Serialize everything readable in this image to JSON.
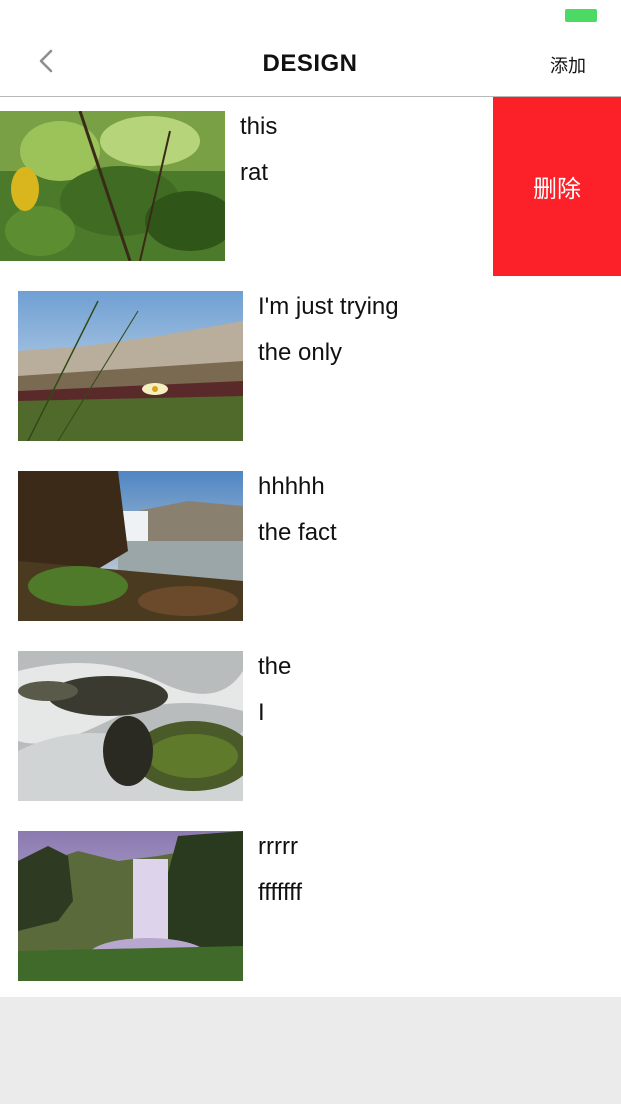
{
  "nav": {
    "title": "DESIGN",
    "add_label": "添加",
    "back_icon": "chevron-left-icon"
  },
  "status": {
    "battery_color": "#4cd964"
  },
  "colors": {
    "delete_bg": "#fc2029",
    "background": "#ebebeb"
  },
  "rows": [
    {
      "title": "this",
      "subtitle": "rat",
      "image": "lemon-tree-photo",
      "swiped": true,
      "delete_label": "删除"
    },
    {
      "title": "I'm just trying",
      "subtitle": "the only",
      "image": "dune-grass-flower-photo"
    },
    {
      "title": "hhhhh",
      "subtitle": "the fact",
      "image": "waterfall-cliff-photo"
    },
    {
      "title": "the",
      "subtitle": "I",
      "image": "river-rocks-long-exposure-photo"
    },
    {
      "title": "rrrrr",
      "subtitle": "fffffff",
      "image": "purple-waterfall-photo"
    }
  ]
}
